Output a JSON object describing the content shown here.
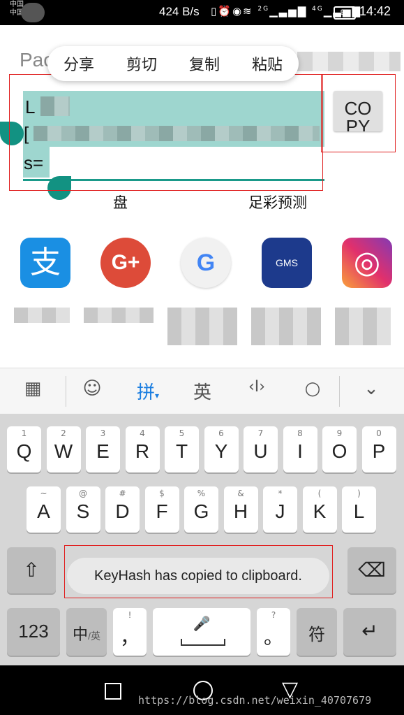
{
  "status": {
    "carrier1": "中国",
    "carrier2": "中国",
    "net_speed": "424 B/s",
    "icons": "▯⏰👁📶",
    "signal_2g": "2G",
    "signal_4g": "4G",
    "battery": "91",
    "time": "14:42"
  },
  "context_menu": {
    "share": "分享",
    "cut": "剪切",
    "copy": "复制",
    "paste": "粘贴"
  },
  "page": {
    "title_partial": "Pac",
    "line1_prefix": "L",
    "line2_prefix": "[",
    "line3_prefix": "s=",
    "copy_button": "CO PY",
    "label_left": "盘",
    "label_right": "足彩预测"
  },
  "apps": [
    {
      "name": "alipay-icon",
      "glyph": "支",
      "color": "#1a8fe3"
    },
    {
      "name": "google-plus-icon",
      "glyph": "G+",
      "color": "#dd4b39"
    },
    {
      "name": "google-go-icon",
      "glyph": "G",
      "color": "#f1f1f1"
    },
    {
      "name": "gms-icon",
      "glyph": "GMS",
      "color": "#1d3a8c"
    },
    {
      "name": "instagram-icon",
      "glyph": "◎",
      "color": "#c1358a"
    }
  ],
  "ime_toolbar": {
    "grid": "▦",
    "emoji": "☺",
    "pinyin": "拼",
    "english": "英",
    "cursor": "‹I›",
    "search": "○",
    "collapse": "⌄"
  },
  "keyboard": {
    "row1": [
      {
        "sub": "1",
        "main": "Q"
      },
      {
        "sub": "2",
        "main": "W"
      },
      {
        "sub": "3",
        "main": "E"
      },
      {
        "sub": "4",
        "main": "R"
      },
      {
        "sub": "5",
        "main": "T"
      },
      {
        "sub": "6",
        "main": "Y"
      },
      {
        "sub": "7",
        "main": "U"
      },
      {
        "sub": "8",
        "main": "I"
      },
      {
        "sub": "9",
        "main": "O"
      },
      {
        "sub": "0",
        "main": "P"
      }
    ],
    "row2": [
      {
        "sub": "~",
        "main": "A"
      },
      {
        "sub": "@",
        "main": "S"
      },
      {
        "sub": "#",
        "main": "D"
      },
      {
        "sub": "$",
        "main": "F"
      },
      {
        "sub": "%",
        "main": "G"
      },
      {
        "sub": "&",
        "main": "H"
      },
      {
        "sub": "*",
        "main": "J"
      },
      {
        "sub": "(",
        "main": "K"
      },
      {
        "sub": ")",
        "main": "L"
      }
    ],
    "shift": "⇧",
    "backspace": "⌫",
    "num": "123",
    "lang_main": "中",
    "lang_sub": "/英",
    "comma_sub": "!",
    "comma": "，",
    "mic": "🎤",
    "period_sub": "?",
    "period": "。",
    "symbol": "符",
    "enter": "↵"
  },
  "toast": "KeyHash has copied to clipboard.",
  "nav": {
    "recent": "□",
    "home": "○",
    "back": "▽"
  },
  "watermark": "https://blog.csdn.net/weixin_40707679"
}
